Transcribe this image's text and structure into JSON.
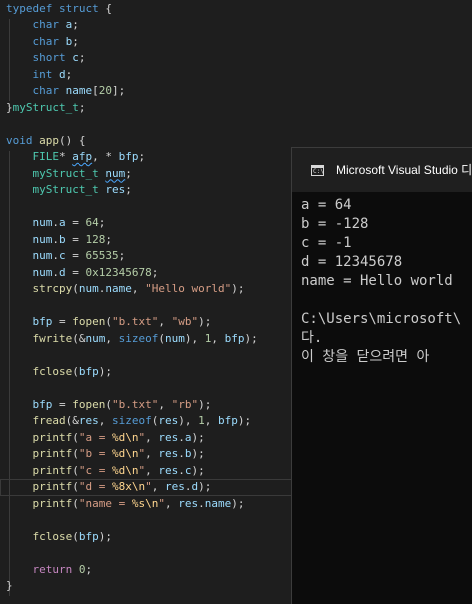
{
  "editor": {
    "lines": [
      [
        [
          "kw",
          "typedef"
        ],
        [
          "pl",
          " "
        ],
        [
          "kw",
          "struct"
        ],
        [
          "pl",
          " {"
        ]
      ],
      [
        [
          "pl",
          "    "
        ],
        [
          "kw",
          "char"
        ],
        [
          "pl",
          " "
        ],
        [
          "id",
          "a"
        ],
        [
          "pl",
          ";"
        ]
      ],
      [
        [
          "pl",
          "    "
        ],
        [
          "kw",
          "char"
        ],
        [
          "pl",
          " "
        ],
        [
          "id",
          "b"
        ],
        [
          "pl",
          ";"
        ]
      ],
      [
        [
          "pl",
          "    "
        ],
        [
          "kw",
          "short"
        ],
        [
          "pl",
          " "
        ],
        [
          "id",
          "c"
        ],
        [
          "pl",
          ";"
        ]
      ],
      [
        [
          "pl",
          "    "
        ],
        [
          "kw",
          "int"
        ],
        [
          "pl",
          " "
        ],
        [
          "id",
          "d"
        ],
        [
          "pl",
          ";"
        ]
      ],
      [
        [
          "pl",
          "    "
        ],
        [
          "kw",
          "char"
        ],
        [
          "pl",
          " "
        ],
        [
          "id",
          "name"
        ],
        [
          "pl",
          "["
        ],
        [
          "nu",
          "20"
        ],
        [
          "pl",
          "];"
        ]
      ],
      [
        [
          "pl",
          "}"
        ],
        [
          "ty",
          "myStruct_t"
        ],
        [
          "pl",
          ";"
        ]
      ],
      [],
      [
        [
          "kw",
          "void"
        ],
        [
          "pl",
          " "
        ],
        [
          "fn",
          "app"
        ],
        [
          "pl",
          "() {"
        ]
      ],
      [
        [
          "pl",
          "    "
        ],
        [
          "ty",
          "FILE"
        ],
        [
          "pl",
          "* "
        ],
        [
          "id sq",
          "afp"
        ],
        [
          "pl",
          ", * "
        ],
        [
          "id",
          "bfp"
        ],
        [
          "pl",
          ";"
        ]
      ],
      [
        [
          "pl",
          "    "
        ],
        [
          "ty",
          "myStruct_t"
        ],
        [
          "pl",
          " "
        ],
        [
          "id sq",
          "num"
        ],
        [
          "pl",
          ";"
        ]
      ],
      [
        [
          "pl",
          "    "
        ],
        [
          "ty",
          "myStruct_t"
        ],
        [
          "pl",
          " "
        ],
        [
          "id",
          "res"
        ],
        [
          "pl",
          ";"
        ]
      ],
      [],
      [
        [
          "pl",
          "    "
        ],
        [
          "id",
          "num"
        ],
        [
          "pl",
          "."
        ],
        [
          "id",
          "a"
        ],
        [
          "pl",
          " = "
        ],
        [
          "nu",
          "64"
        ],
        [
          "pl",
          ";"
        ]
      ],
      [
        [
          "pl",
          "    "
        ],
        [
          "id",
          "num"
        ],
        [
          "pl",
          "."
        ],
        [
          "id",
          "b"
        ],
        [
          "pl",
          " = "
        ],
        [
          "nu",
          "128"
        ],
        [
          "pl",
          ";"
        ]
      ],
      [
        [
          "pl",
          "    "
        ],
        [
          "id",
          "num"
        ],
        [
          "pl",
          "."
        ],
        [
          "id",
          "c"
        ],
        [
          "pl",
          " = "
        ],
        [
          "nu",
          "65535"
        ],
        [
          "pl",
          ";"
        ]
      ],
      [
        [
          "pl",
          "    "
        ],
        [
          "id",
          "num"
        ],
        [
          "pl",
          "."
        ],
        [
          "id",
          "d"
        ],
        [
          "pl",
          " = "
        ],
        [
          "nu",
          "0x12345678"
        ],
        [
          "pl",
          ";"
        ]
      ],
      [
        [
          "pl",
          "    "
        ],
        [
          "fn",
          "strcpy"
        ],
        [
          "pl",
          "("
        ],
        [
          "id",
          "num"
        ],
        [
          "pl",
          "."
        ],
        [
          "id",
          "name"
        ],
        [
          "pl",
          ", "
        ],
        [
          "st",
          "\"Hello world\""
        ],
        [
          "pl",
          ");"
        ]
      ],
      [],
      [
        [
          "pl",
          "    "
        ],
        [
          "id",
          "bfp"
        ],
        [
          "pl",
          " = "
        ],
        [
          "fn",
          "fopen"
        ],
        [
          "pl",
          "("
        ],
        [
          "st",
          "\"b.txt\""
        ],
        [
          "pl",
          ", "
        ],
        [
          "st",
          "\"wb\""
        ],
        [
          "pl",
          ");"
        ]
      ],
      [
        [
          "pl",
          "    "
        ],
        [
          "fn",
          "fwrite"
        ],
        [
          "pl",
          "(&"
        ],
        [
          "id",
          "num"
        ],
        [
          "pl",
          ", "
        ],
        [
          "kw",
          "sizeof"
        ],
        [
          "pl",
          "("
        ],
        [
          "id",
          "num"
        ],
        [
          "pl",
          "), "
        ],
        [
          "nu",
          "1"
        ],
        [
          "pl",
          ", "
        ],
        [
          "id",
          "bfp"
        ],
        [
          "pl",
          ");"
        ]
      ],
      [],
      [
        [
          "pl",
          "    "
        ],
        [
          "fn",
          "fclose"
        ],
        [
          "pl",
          "("
        ],
        [
          "id",
          "bfp"
        ],
        [
          "pl",
          ");"
        ]
      ],
      [],
      [
        [
          "pl",
          "    "
        ],
        [
          "id",
          "bfp"
        ],
        [
          "pl",
          " = "
        ],
        [
          "fn",
          "fopen"
        ],
        [
          "pl",
          "("
        ],
        [
          "st",
          "\"b.txt\""
        ],
        [
          "pl",
          ", "
        ],
        [
          "st",
          "\"rb\""
        ],
        [
          "pl",
          ");"
        ]
      ],
      [
        [
          "pl",
          "    "
        ],
        [
          "fn",
          "fread"
        ],
        [
          "pl",
          "(&"
        ],
        [
          "id",
          "res"
        ],
        [
          "pl",
          ", "
        ],
        [
          "kw",
          "sizeof"
        ],
        [
          "pl",
          "("
        ],
        [
          "id",
          "res"
        ],
        [
          "pl",
          "), "
        ],
        [
          "nu",
          "1"
        ],
        [
          "pl",
          ", "
        ],
        [
          "id",
          "bfp"
        ],
        [
          "pl",
          ");"
        ]
      ],
      [
        [
          "pl",
          "    "
        ],
        [
          "fn",
          "printf"
        ],
        [
          "pl",
          "("
        ],
        [
          "st",
          "\"a = "
        ],
        [
          "es",
          "%d\\n"
        ],
        [
          "st",
          "\""
        ],
        [
          "pl",
          ", "
        ],
        [
          "id",
          "res"
        ],
        [
          "pl",
          "."
        ],
        [
          "id",
          "a"
        ],
        [
          "pl",
          ");"
        ]
      ],
      [
        [
          "pl",
          "    "
        ],
        [
          "fn",
          "printf"
        ],
        [
          "pl",
          "("
        ],
        [
          "st",
          "\"b = "
        ],
        [
          "es",
          "%d\\n"
        ],
        [
          "st",
          "\""
        ],
        [
          "pl",
          ", "
        ],
        [
          "id",
          "res"
        ],
        [
          "pl",
          "."
        ],
        [
          "id",
          "b"
        ],
        [
          "pl",
          ");"
        ]
      ],
      [
        [
          "pl",
          "    "
        ],
        [
          "fn",
          "printf"
        ],
        [
          "pl",
          "("
        ],
        [
          "st",
          "\"c = "
        ],
        [
          "es",
          "%d\\n"
        ],
        [
          "st",
          "\""
        ],
        [
          "pl",
          ", "
        ],
        [
          "id",
          "res"
        ],
        [
          "pl",
          "."
        ],
        [
          "id",
          "c"
        ],
        [
          "pl",
          ");"
        ]
      ],
      [
        [
          "pl",
          "    "
        ],
        [
          "fn",
          "printf"
        ],
        [
          "pl",
          "("
        ],
        [
          "st",
          "\"d = "
        ],
        [
          "es",
          "%8x\\n"
        ],
        [
          "st",
          "\""
        ],
        [
          "pl",
          ", "
        ],
        [
          "id",
          "res"
        ],
        [
          "pl",
          "."
        ],
        [
          "id",
          "d"
        ],
        [
          "pl",
          ");"
        ]
      ],
      [
        [
          "pl",
          "    "
        ],
        [
          "fn",
          "printf"
        ],
        [
          "pl",
          "("
        ],
        [
          "st",
          "\"name = "
        ],
        [
          "es",
          "%s\\n"
        ],
        [
          "st",
          "\""
        ],
        [
          "pl",
          ", "
        ],
        [
          "id",
          "res"
        ],
        [
          "pl",
          "."
        ],
        [
          "id",
          "name"
        ],
        [
          "pl",
          ");"
        ]
      ],
      [],
      [
        [
          "pl",
          "    "
        ],
        [
          "fn",
          "fclose"
        ],
        [
          "pl",
          "("
        ],
        [
          "id",
          "bfp"
        ],
        [
          "pl",
          ");"
        ]
      ],
      [],
      [
        [
          "pl",
          "    "
        ],
        [
          "mc",
          "return"
        ],
        [
          "pl",
          " "
        ],
        [
          "nu",
          "0"
        ],
        [
          "pl",
          ";"
        ]
      ],
      [
        [
          "pl",
          "}"
        ]
      ]
    ]
  },
  "console": {
    "title": "Microsoft Visual Studio 디",
    "icon": "console-app-icon",
    "output": [
      "a = 64",
      "b = -128",
      "c = -1",
      "d = 12345678",
      "name = Hello world",
      "",
      "C:\\Users\\microsoft\\",
      "다.",
      "이 창을 닫으려면 아"
    ]
  }
}
